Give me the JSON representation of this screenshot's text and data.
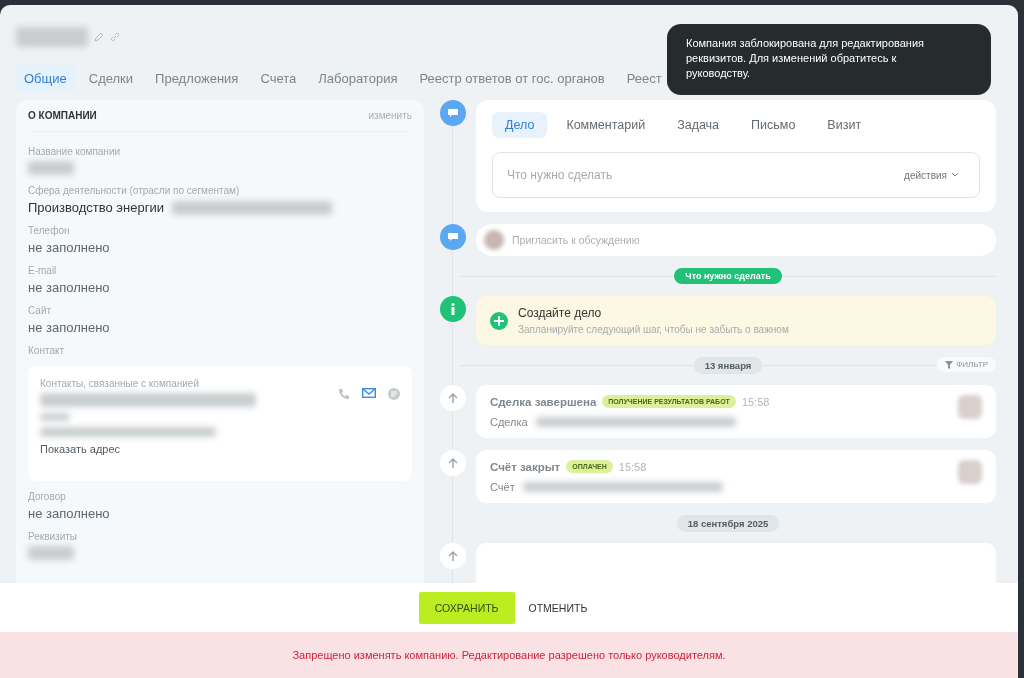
{
  "tabs": [
    {
      "label": "Общие",
      "selected": true
    },
    {
      "label": "Сделки",
      "selected": false
    },
    {
      "label": "Предложения",
      "selected": false
    },
    {
      "label": "Счета",
      "selected": false
    },
    {
      "label": "Лаборатория",
      "selected": false
    },
    {
      "label": "Реестр ответов от гос. органов",
      "selected": false
    },
    {
      "label": "Реест",
      "selected": false
    }
  ],
  "toast": {
    "text": "Компания заблокирована для редактирования реквизитов. Для изменений обратитесь к руководству."
  },
  "about": {
    "title": "О КОМПАНИИ",
    "edit": "изменить",
    "fields": [
      {
        "kind": "blurred",
        "label": "Название компании"
      },
      {
        "kind": "text",
        "label": "Сфера деятельности (отрасли по сегментам)",
        "value": "Производство энергии"
      },
      {
        "kind": "text",
        "label": "Телефон",
        "value": "не заполнено"
      },
      {
        "kind": "text",
        "label": "E-mail",
        "value": "не заполнено"
      },
      {
        "kind": "text",
        "label": "Сайт",
        "value": "не заполнено"
      },
      {
        "kind": "contact",
        "label": "Контакт",
        "sublabel": "Контакты, связанные с компанией",
        "link": "Показать адрес"
      },
      {
        "kind": "text",
        "label": "Договор",
        "value": "не заполнено"
      },
      {
        "kind": "blurred",
        "label": "Реквизиты"
      }
    ]
  },
  "composer": {
    "tabs": [
      {
        "label": "Дело",
        "selected": true
      },
      {
        "label": "Комментарий",
        "selected": false
      },
      {
        "label": "Задача",
        "selected": false
      },
      {
        "label": "Письмо",
        "selected": false
      },
      {
        "label": "Визит",
        "selected": false
      }
    ],
    "placeholder": "Что нужно сделать",
    "actions": "действия"
  },
  "invite": {
    "placeholder": "Пригласить к обсуждению"
  },
  "todo_badge": "Что нужно сделать",
  "create": {
    "title": "Создайте дело",
    "subtitle": "Запланируйте следующий шаг, чтобы не забыть о важном"
  },
  "date_1": "13 января",
  "filter": "ФИЛЬТР",
  "events": [
    {
      "title": "Сделка завершена",
      "tag": "ПОЛУЧЕНИЕ РЕЗУЛЬТАТОВ РАБОТ",
      "time": "15:58",
      "label": "Сделка"
    },
    {
      "title": "Счёт закрыт",
      "tag": "ОПЛАЧЕН",
      "time": "15:58",
      "label": "Счёт"
    }
  ],
  "date_2": "18 сентября 2025",
  "footer": {
    "save": "СОХРАНИТЬ",
    "cancel": "ОТМЕНИТЬ"
  },
  "error": "Запрещено изменять компанию. Редактирование разрешено только руководителям."
}
